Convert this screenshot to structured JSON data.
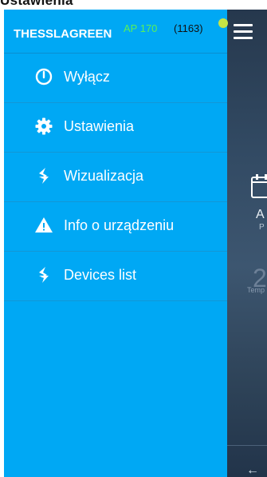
{
  "top_caption": "Ustawienia",
  "drawer": {
    "brand": "THESSLAGREEN",
    "ap": "AP 170",
    "count": "(1163)",
    "status_color": "#c7e545",
    "accent": "#00a8f4",
    "items": [
      {
        "label": "Wyłącz",
        "icon": "power-icon"
      },
      {
        "label": "Ustawienia",
        "icon": "gear-icon"
      },
      {
        "label": "Wizualizacja",
        "icon": "logo-icon"
      },
      {
        "label": "Info o urządzeniu",
        "icon": "warning-icon"
      },
      {
        "label": "Devices list",
        "icon": "logo-icon"
      }
    ]
  },
  "main": {
    "text1": "A",
    "text2": "P",
    "big": "2",
    "small": "Temp",
    "back_icon": "←"
  }
}
